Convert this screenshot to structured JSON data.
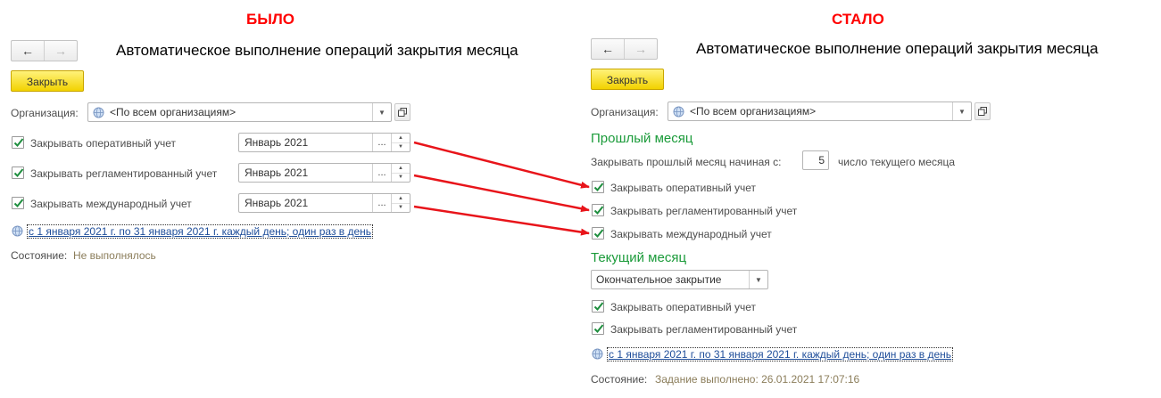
{
  "headings": {
    "before": "БЫЛО",
    "after": "СТАЛО"
  },
  "colors": {
    "accent_red": "#ff0000",
    "section_green": "#1b9b3a",
    "link_blue": "#1f4e9a",
    "button_yellow": "#f7e04a"
  },
  "left": {
    "title": "Автоматическое выполнение операций закрытия месяца",
    "close_button": "Закрыть",
    "org_label": "Организация:",
    "org_value": "<По всем организациям>",
    "rows": [
      {
        "label": "Закрывать оперативный учет",
        "checked": true,
        "period": "Январь 2021"
      },
      {
        "label": "Закрывать регламентированный учет",
        "checked": true,
        "period": "Январь 2021"
      },
      {
        "label": "Закрывать международный учет",
        "checked": true,
        "period": "Январь 2021"
      }
    ],
    "schedule_link": "с 1 января 2021 г. по 31 января 2021 г. каждый день; один раз в день",
    "status_label": "Состояние:",
    "status_value": "Не выполнялось"
  },
  "right": {
    "title": "Автоматическое выполнение операций закрытия месяца",
    "close_button": "Закрыть",
    "org_label": "Организация:",
    "org_value": "<По всем организациям>",
    "prev_month": {
      "heading": "Прошлый месяц",
      "start_label": "Закрывать прошлый месяц начиная с:",
      "start_day": "5",
      "start_suffix": "число текущего месяца",
      "items": [
        {
          "label": "Закрывать оперативный учет",
          "checked": true
        },
        {
          "label": "Закрывать регламентированный учет",
          "checked": true
        },
        {
          "label": "Закрывать международный учет",
          "checked": true
        }
      ]
    },
    "current_month": {
      "heading": "Текущий месяц",
      "mode_value": "Окончательное закрытие",
      "items": [
        {
          "label": "Закрывать оперативный учет",
          "checked": true
        },
        {
          "label": "Закрывать регламентированный учет",
          "checked": true
        }
      ]
    },
    "schedule_link": "с 1 января 2021 г. по 31 января 2021 г. каждый день; один раз в день",
    "status_label": "Состояние:",
    "status_value": "Задание выполнено: 26.01.2021 17:07:16"
  },
  "icons": {
    "back": "arrow-left-icon",
    "forward": "arrow-right-icon",
    "globe": "globe-icon",
    "dropdown": "chevron-down-icon",
    "open": "open-form-icon",
    "check": "checkmark-icon"
  }
}
